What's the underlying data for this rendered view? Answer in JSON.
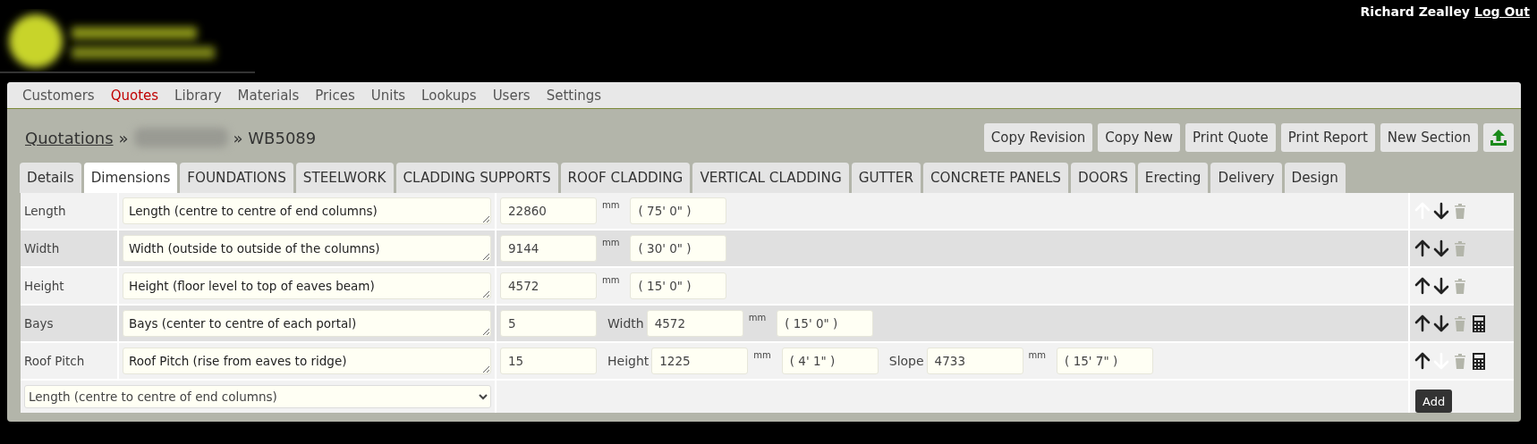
{
  "user": {
    "name": "Richard Zealley",
    "logout": "Log Out"
  },
  "nav": [
    {
      "label": "Customers",
      "selected": false
    },
    {
      "label": "Quotes",
      "selected": true
    },
    {
      "label": "Library",
      "selected": false
    },
    {
      "label": "Materials",
      "selected": false
    },
    {
      "label": "Prices",
      "selected": false
    },
    {
      "label": "Units",
      "selected": false
    },
    {
      "label": "Lookups",
      "selected": false
    },
    {
      "label": "Users",
      "selected": false
    },
    {
      "label": "Settings",
      "selected": false
    }
  ],
  "breadcrumb": {
    "root": "Quotations",
    "separator": "»",
    "current": "» WB5089"
  },
  "actions": [
    "Copy Revision",
    "Copy New",
    "Print Quote",
    "Print Report",
    "New Section"
  ],
  "tabs": [
    {
      "label": "Details",
      "selected": false
    },
    {
      "label": "Dimensions",
      "selected": true
    },
    {
      "label": "FOUNDATIONS",
      "selected": false
    },
    {
      "label": "STEELWORK",
      "selected": false
    },
    {
      "label": "CLADDING SUPPORTS",
      "selected": false
    },
    {
      "label": "ROOF CLADDING",
      "selected": false
    },
    {
      "label": "VERTICAL CLADDING",
      "selected": false
    },
    {
      "label": "GUTTER",
      "selected": false
    },
    {
      "label": "CONCRETE PANELS",
      "selected": false
    },
    {
      "label": "DOORS",
      "selected": false
    },
    {
      "label": "Erecting",
      "selected": false
    },
    {
      "label": "Delivery",
      "selected": false
    },
    {
      "label": "Design",
      "selected": false
    }
  ],
  "rows": [
    {
      "label": "Length",
      "description": "Length (centre to centre of end columns)",
      "value": "22860",
      "measures": [
        {
          "unit": "mm",
          "imperial": "( 75' 0\" )"
        }
      ],
      "up_disabled": true,
      "down_disabled": false,
      "calculator": false
    },
    {
      "label": "Width",
      "description": "Width (outside to outside of the columns)",
      "value": "9144",
      "measures": [
        {
          "unit": "mm",
          "imperial": "( 30' 0\" )"
        }
      ],
      "up_disabled": false,
      "down_disabled": false,
      "calculator": false
    },
    {
      "label": "Height",
      "description": "Height (floor level to top of eaves beam)",
      "value": "4572",
      "measures": [
        {
          "unit": "mm",
          "imperial": "( 15' 0\" )"
        }
      ],
      "up_disabled": false,
      "down_disabled": false,
      "calculator": false
    },
    {
      "label": "Bays",
      "description": "Bays (center to centre of each portal)",
      "value": "5",
      "measures": [
        {
          "label": "Width",
          "value": "4572",
          "unit": "mm",
          "imperial": "( 15' 0\" )"
        }
      ],
      "up_disabled": false,
      "down_disabled": false,
      "calculator": true
    },
    {
      "label": "Roof Pitch",
      "description": "Roof Pitch (rise from eaves to ridge)",
      "value": "15",
      "measures": [
        {
          "label": "Height",
          "value": "1225",
          "unit": "mm",
          "imperial": "( 4' 1\" )"
        },
        {
          "label": "Slope",
          "value": "4733",
          "unit": "mm",
          "imperial": "( 15' 7\" )"
        }
      ],
      "up_disabled": false,
      "down_disabled": true,
      "calculator": true
    }
  ],
  "add_row": {
    "select": "Length (centre to centre of end columns)",
    "button": "Add"
  }
}
